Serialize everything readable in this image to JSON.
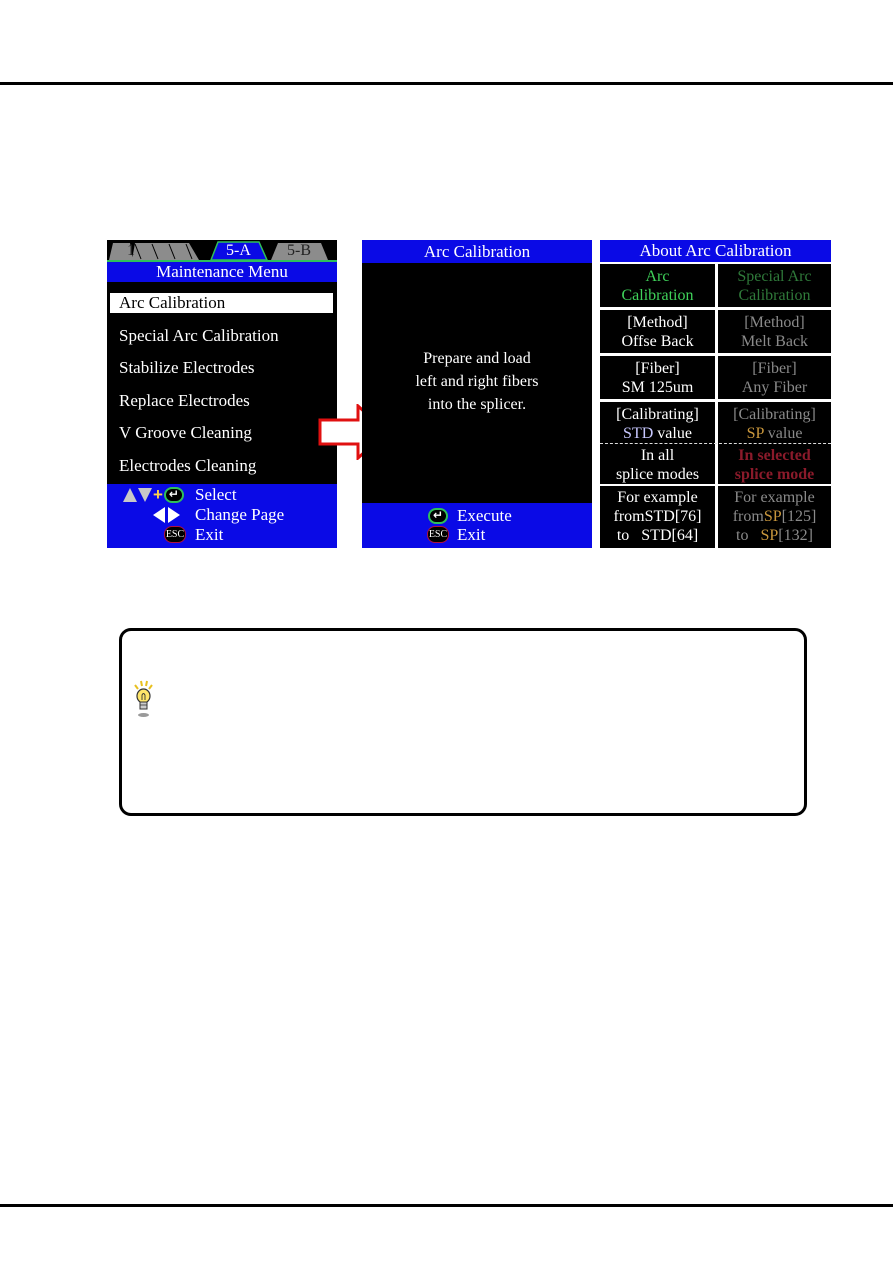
{
  "page": {
    "rules": [
      "top",
      "bottom"
    ]
  },
  "maintenance_screen": {
    "tabs": [
      {
        "label": "1",
        "active": false
      },
      {
        "label": "",
        "active": false
      },
      {
        "label": "",
        "active": false
      },
      {
        "label": "",
        "active": false
      },
      {
        "label": "5-A",
        "active": true
      },
      {
        "label": "5-B",
        "active": false
      }
    ],
    "title": "Maintenance Menu",
    "menu_items": [
      {
        "label": "Arc Calibration",
        "selected": true
      },
      {
        "label": "Special Arc Calibration",
        "selected": false
      },
      {
        "label": "Stabilize Electrodes",
        "selected": false
      },
      {
        "label": "Replace Electrodes",
        "selected": false
      },
      {
        "label": "V Groove Cleaning",
        "selected": false
      },
      {
        "label": "Electrodes Cleaning",
        "selected": false
      }
    ],
    "hints": {
      "select": {
        "icons": [
          "up-arrow-icon",
          "down-arrow-icon",
          "plus",
          "enter-key-icon"
        ],
        "label": "Select",
        "plus_text": "+",
        "enter_glyph": "↵"
      },
      "change_page": {
        "icons": [
          "left-arrow-icon",
          "right-arrow-icon"
        ],
        "label": "Change Page"
      },
      "exit": {
        "icons": [
          "esc-key-icon"
        ],
        "label": "Exit",
        "esc_text": "ESC"
      }
    }
  },
  "arrow": {
    "icon": "right-arrow-icon",
    "fill": "#ffffff",
    "stroke": "#e01010"
  },
  "arc_calibration_screen": {
    "title": "Arc Calibration",
    "prompt_lines": [
      "Prepare and load",
      "left and right fibers",
      "into the splicer."
    ],
    "hints": {
      "execute": {
        "label": "Execute",
        "enter_glyph": "↵"
      },
      "exit": {
        "label": "Exit",
        "esc_text": "ESC"
      }
    }
  },
  "about_screen": {
    "title": "About Arc Calibration",
    "rows": [
      {
        "left": [
          {
            "text": "Arc",
            "color": "green"
          },
          {
            "text": "Calibration",
            "color": "green"
          }
        ],
        "right": [
          {
            "text": "Special Arc",
            "color": "dkgreen"
          },
          {
            "text": "Calibration",
            "color": "dkgreen"
          }
        ]
      },
      {
        "left": [
          {
            "text": "[Method]",
            "color": "white"
          },
          {
            "text": "Offse Back",
            "color": "white"
          }
        ],
        "right": [
          {
            "text": "[Method]",
            "color": "gray"
          },
          {
            "text": "Melt Back",
            "color": "gray"
          }
        ]
      },
      {
        "left": [
          {
            "text": "[Fiber]",
            "color": "white"
          },
          {
            "text": "SM 125um",
            "color": "white"
          }
        ],
        "right": [
          {
            "text": "[Fiber]",
            "color": "gray"
          },
          {
            "text": "Any Fiber",
            "color": "gray"
          }
        ]
      },
      {
        "left_line1": "[Calibrating]",
        "left_line2_prefix": "STD",
        "left_line2_suffix": " value",
        "right_line1": "[Calibrating]",
        "right_line2_prefix": "SP",
        "right_line2_suffix": " value"
      },
      {
        "left": [
          {
            "text": "In all",
            "color": "white"
          },
          {
            "text": "splice modes",
            "color": "white"
          }
        ],
        "right": [
          {
            "text": "In selected",
            "color": "red"
          },
          {
            "text": "splice mode",
            "color": "red"
          }
        ]
      },
      {
        "left_example": {
          "line1": "For example",
          "from_word": "from",
          "from_code": "STD",
          "from_value": "[76]",
          "to_word": "to",
          "to_code": "STD",
          "to_value": "[64]"
        },
        "right_example": {
          "line1": "For example",
          "from_word": "from",
          "from_code": "SP",
          "from_value": "[125]",
          "to_word": "to",
          "to_code": "SP",
          "to_value": "[132]"
        }
      }
    ],
    "colors": {
      "title_bar": "#0a0ae6",
      "green": "#3fd25a",
      "dkgreen": "#2f7a3a",
      "gray": "#8a8a8a",
      "std_blue": "#c8c8ff",
      "sp_orange": "#c8963c",
      "red": "#8a1a2a"
    }
  },
  "note": {
    "icon": "lightbulb-icon",
    "text": ""
  }
}
